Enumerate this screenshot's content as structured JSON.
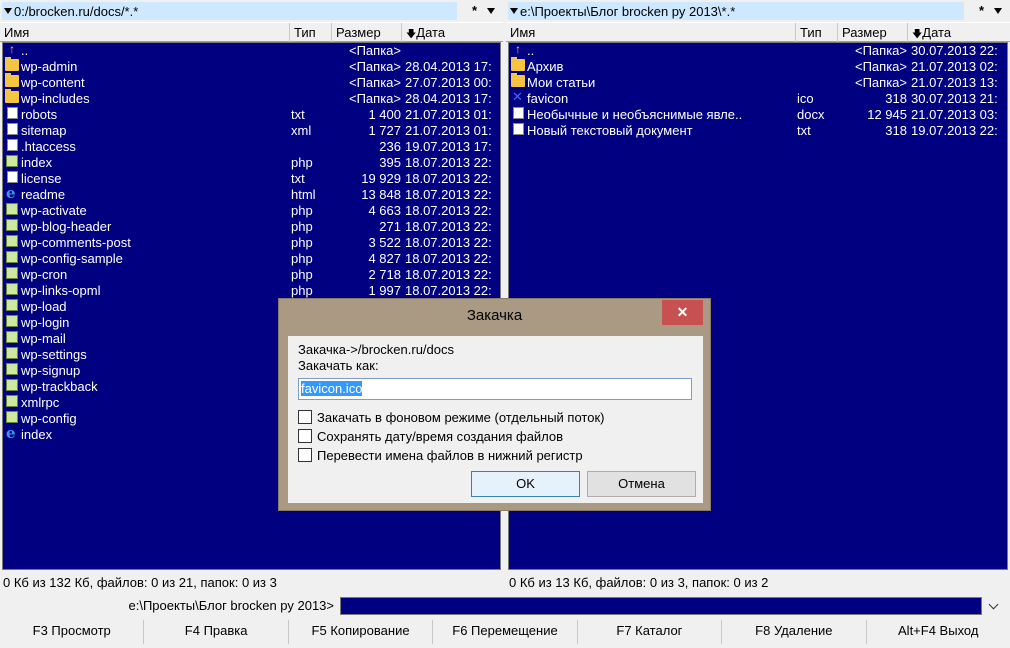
{
  "left": {
    "path": "0:/brocken.ru/docs/*.*",
    "star": "*",
    "columns": {
      "name": "Имя",
      "type": "Тип",
      "size": "Размер",
      "date": "Дата"
    },
    "files": [
      {
        "icon": "up",
        "name": "..",
        "ext": "",
        "size": "<Папка>",
        "date": ""
      },
      {
        "icon": "folder",
        "name": "wp-admin",
        "ext": "",
        "size": "<Папка>",
        "date": "28.04.2013 17:"
      },
      {
        "icon": "folder",
        "name": "wp-content",
        "ext": "",
        "size": "<Папка>",
        "date": "27.07.2013 00:"
      },
      {
        "icon": "folder",
        "name": "wp-includes",
        "ext": "",
        "size": "<Папка>",
        "date": "28.04.2013 17:"
      },
      {
        "icon": "doc",
        "name": "robots",
        "ext": "txt",
        "size": "1 400",
        "date": "21.07.2013 01:"
      },
      {
        "icon": "doc",
        "name": "sitemap",
        "ext": "xml",
        "size": "1 727",
        "date": "21.07.2013 01:"
      },
      {
        "icon": "doc",
        "name": ".htaccess",
        "ext": "",
        "size": "236",
        "date": "19.07.2013 17:"
      },
      {
        "icon": "php",
        "name": "index",
        "ext": "php",
        "size": "395",
        "date": "18.07.2013 22:"
      },
      {
        "icon": "doc",
        "name": "license",
        "ext": "txt",
        "size": "19 929",
        "date": "18.07.2013 22:"
      },
      {
        "icon": "ie",
        "name": "readme",
        "ext": "html",
        "size": "13 848",
        "date": "18.07.2013 22:"
      },
      {
        "icon": "php",
        "name": "wp-activate",
        "ext": "php",
        "size": "4 663",
        "date": "18.07.2013 22:"
      },
      {
        "icon": "php",
        "name": "wp-blog-header",
        "ext": "php",
        "size": "271",
        "date": "18.07.2013 22:"
      },
      {
        "icon": "php",
        "name": "wp-comments-post",
        "ext": "php",
        "size": "3 522",
        "date": "18.07.2013 22:"
      },
      {
        "icon": "php",
        "name": "wp-config-sample",
        "ext": "php",
        "size": "4 827",
        "date": "18.07.2013 22:"
      },
      {
        "icon": "php",
        "name": "wp-cron",
        "ext": "php",
        "size": "2 718",
        "date": "18.07.2013 22:"
      },
      {
        "icon": "php",
        "name": "wp-links-opml",
        "ext": "php",
        "size": "1 997",
        "date": "18.07.2013 22:"
      },
      {
        "icon": "php",
        "name": "wp-load",
        "ext": "",
        "size": "",
        "date": ""
      },
      {
        "icon": "php",
        "name": "wp-login",
        "ext": "",
        "size": "",
        "date": ""
      },
      {
        "icon": "php",
        "name": "wp-mail",
        "ext": "",
        "size": "",
        "date": ""
      },
      {
        "icon": "php",
        "name": "wp-settings",
        "ext": "",
        "size": "",
        "date": ""
      },
      {
        "icon": "php",
        "name": "wp-signup",
        "ext": "",
        "size": "",
        "date": ""
      },
      {
        "icon": "php",
        "name": "wp-trackback",
        "ext": "",
        "size": "",
        "date": ""
      },
      {
        "icon": "php",
        "name": "xmlrpc",
        "ext": "",
        "size": "",
        "date": ""
      },
      {
        "icon": "php",
        "name": "wp-config",
        "ext": "",
        "size": "",
        "date": ""
      },
      {
        "icon": "ie",
        "name": "index",
        "ext": "",
        "size": "",
        "date": ""
      }
    ],
    "status": "0 Кб из 132 Кб, файлов: 0 из 21, папок: 0 из 3"
  },
  "right": {
    "path": "e:\\Проекты\\Блог brocken ру 2013\\*.*",
    "star": "*",
    "columns": {
      "name": "Имя",
      "type": "Тип",
      "size": "Размер",
      "date": "Дата"
    },
    "files": [
      {
        "icon": "up",
        "name": "..",
        "ext": "",
        "size": "<Папка>",
        "date": "30.07.2013 22:"
      },
      {
        "icon": "folder",
        "name": "Архив",
        "ext": "",
        "size": "<Папка>",
        "date": "21.07.2013 02:"
      },
      {
        "icon": "folder",
        "name": "Мои статьи",
        "ext": "",
        "size": "<Папка>",
        "date": "21.07.2013 13:"
      },
      {
        "icon": "fav",
        "name": "favicon",
        "ext": "ico",
        "size": "318",
        "date": "30.07.2013 21:"
      },
      {
        "icon": "doc",
        "name": "Необычные и необъяснимые явле..",
        "ext": "docx",
        "size": "12 945",
        "date": "21.07.2013 03:"
      },
      {
        "icon": "doc",
        "name": "Новый текстовый документ",
        "ext": "txt",
        "size": "318",
        "date": "19.07.2013 22:"
      }
    ],
    "status": "0 Кб из 13 Кб, файлов: 0 из 3, папок: 0 из 2"
  },
  "cmdline": {
    "label": "e:\\Проекты\\Блог brocken ру 2013>",
    "value": ""
  },
  "fkeys": [
    "F3 Просмотр",
    "F4 Правка",
    "F5 Копирование",
    "F6 Перемещение",
    "F7 Каталог",
    "F8 Удаление",
    "Alt+F4 Выход"
  ],
  "dialog": {
    "title": "Закачка",
    "close": "✕",
    "line1": "Закачка->/brocken.ru/docs",
    "line2": "Закачать как:",
    "filename": "favicon.ico",
    "options": [
      {
        "label": "Закачать в фоновом режиме (отдельный поток)",
        "checked": false
      },
      {
        "label": "Сохранять дату/время создания файлов",
        "checked": false
      },
      {
        "label": "Перевести имена файлов в нижний регистр",
        "checked": false
      }
    ],
    "ok": "OK",
    "cancel": "Отмена"
  }
}
